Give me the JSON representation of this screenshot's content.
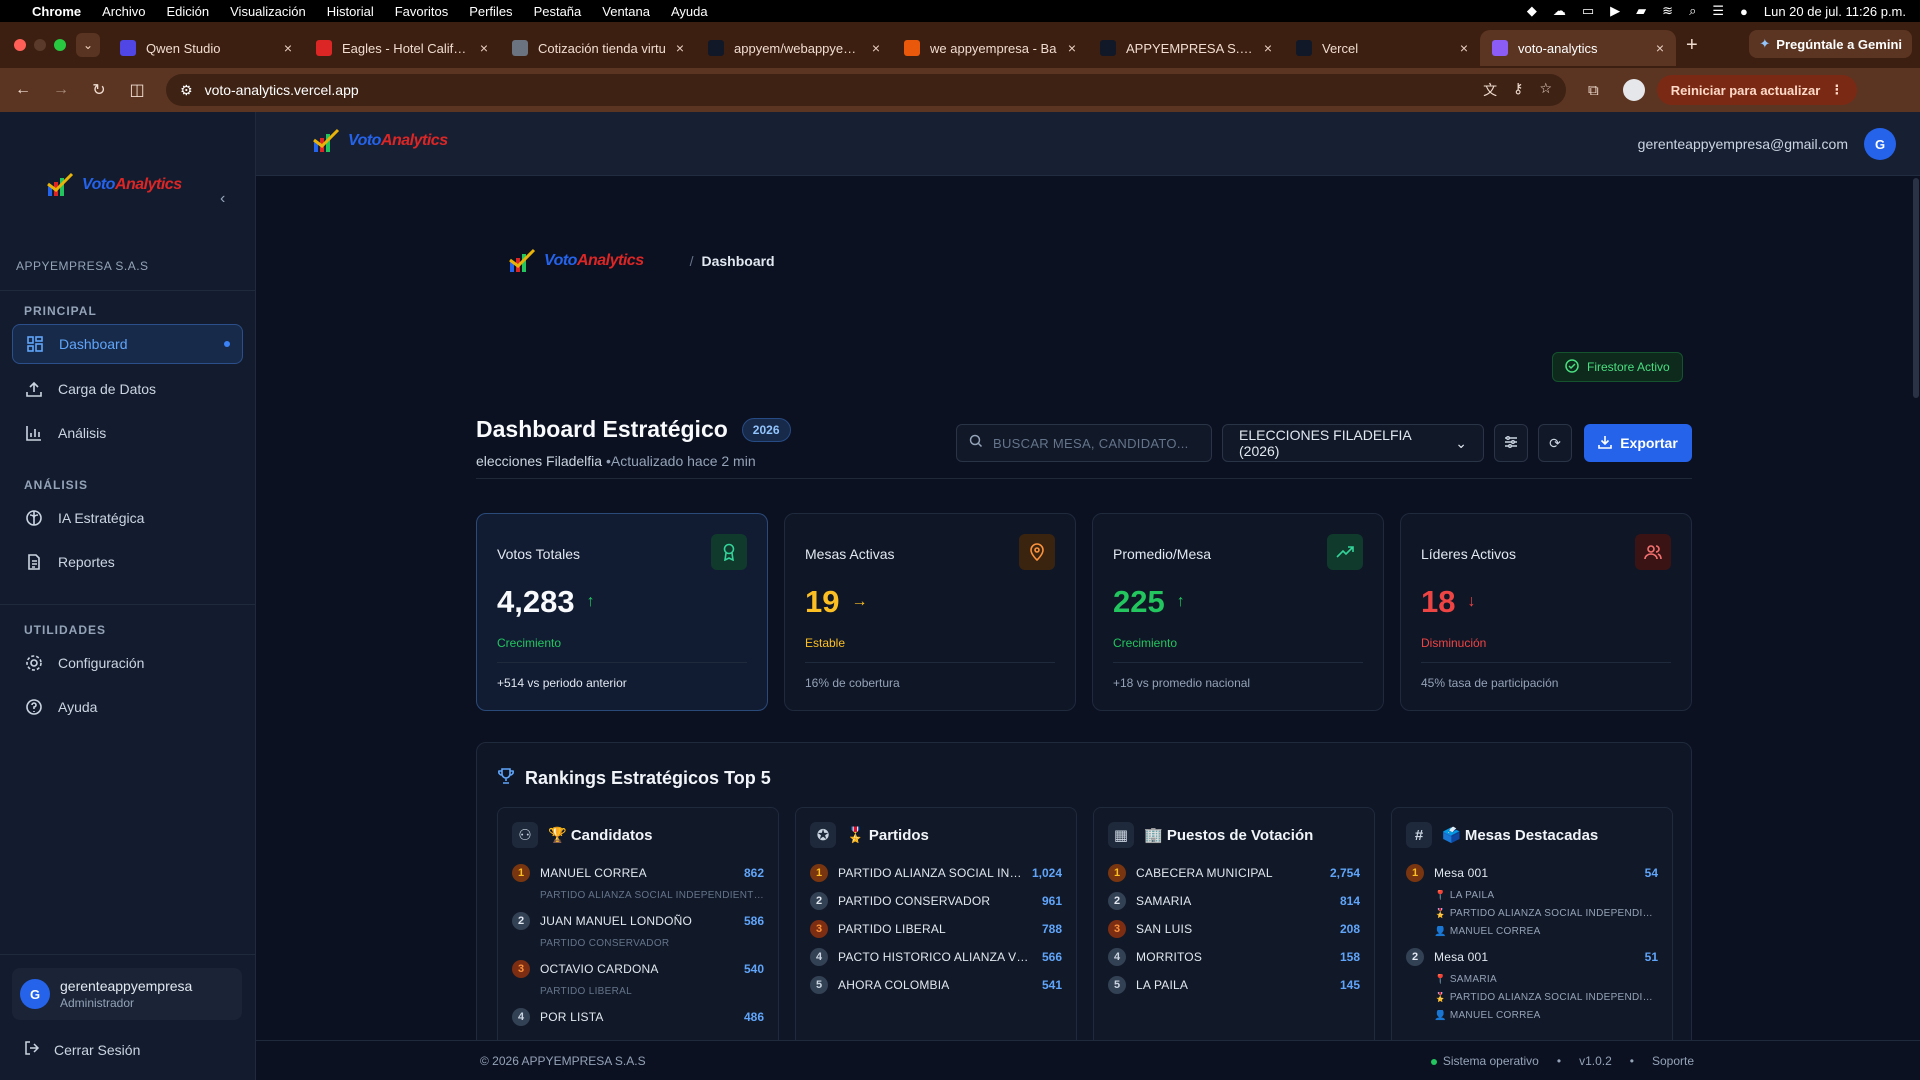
{
  "menubar": {
    "app": "Chrome",
    "items": [
      "Archivo",
      "Edición",
      "Visualización",
      "Historial",
      "Favoritos",
      "Perfiles",
      "Pestaña",
      "Ventana",
      "Ayuda"
    ],
    "datetime": "Lun 20 de jul.  11:26 p.m."
  },
  "tabs": [
    {
      "title": "Qwen Studio",
      "color": "#4f46e5"
    },
    {
      "title": "Eagles - Hotel Californ",
      "color": "#dc2626"
    },
    {
      "title": "Cotización tienda virtu",
      "color": "#6b7280"
    },
    {
      "title": "appyem/webappyempr",
      "color": "#111827"
    },
    {
      "title": "we appyempresa - Ba",
      "color": "#ea580c"
    },
    {
      "title": "APPYEMPRESA S.A.S",
      "color": "#111827"
    },
    {
      "title": "Vercel",
      "color": "#111827"
    },
    {
      "title": "voto-analytics",
      "color": "#8b5cf6"
    }
  ],
  "gemini_label": "Pregúntale a Gemini",
  "url": "voto-analytics.vercel.app",
  "reload_label": "Reiniciar para actualizar",
  "brand": {
    "part1": "Voto",
    "part2": "Analytics"
  },
  "sidebar": {
    "company": "APPYEMPRESA S.A.S",
    "sections": {
      "principal": "PRINCIPAL",
      "analisis": "ANÁLISIS",
      "utilidades": "UTILIDADES"
    },
    "items": {
      "dashboard": "Dashboard",
      "carga": "Carga de Datos",
      "analisis": "Análisis",
      "ia": "IA Estratégica",
      "reportes": "Reportes",
      "config": "Configuración",
      "ayuda": "Ayuda"
    },
    "user": {
      "initial": "G",
      "name": "gerenteappyempresa",
      "role": "Administrador"
    },
    "logout": "Cerrar Sesión"
  },
  "topbar": {
    "email": "gerenteappyempresa@gmail.com",
    "initial": "G"
  },
  "breadcrumb": {
    "sep": "/",
    "page": "Dashboard"
  },
  "firestore": "Firestore Activo",
  "header": {
    "title": "Dashboard Estratégico",
    "year": "2026",
    "subtitle": "elecciones Filadelfia",
    "updated": " •Actualizado hace 2 min"
  },
  "search": {
    "placeholder": "BUSCAR MESA, CANDIDATO..."
  },
  "election_select": "ELECCIONES FILADELFIA (2026)",
  "export_label": "Exportar",
  "cards": [
    {
      "title": "Votos Totales",
      "value": "4,283",
      "arrow": "↑",
      "status": "Crecimiento",
      "foot": "+514 vs periodo anterior",
      "color": "#f8fafc",
      "status_color": "#22c55e",
      "arrow_color": "#22c55e"
    },
    {
      "title": "Mesas Activas",
      "value": "19",
      "arrow": "→",
      "status": "Estable",
      "foot": "16% de cobertura",
      "color": "#fbbf24",
      "status_color": "#fbbf24",
      "arrow_color": "#fbbf24"
    },
    {
      "title": "Promedio/Mesa",
      "value": "225",
      "arrow": "↑",
      "status": "Crecimiento",
      "foot": "+18 vs promedio nacional",
      "color": "#22c55e",
      "status_color": "#22c55e",
      "arrow_color": "#22c55e"
    },
    {
      "title": "Líderes Activos",
      "value": "18",
      "arrow": "↓",
      "status": "Disminución",
      "foot": "45% tasa de participación",
      "color": "#ef4444",
      "status_color": "#ef4444",
      "arrow_color": "#ef4444"
    }
  ],
  "rankings": {
    "title": "Rankings Estratégicos Top 5",
    "candidatos": {
      "title": "🏆 Candidatos",
      "rows": [
        {
          "n": "1",
          "name": "MANUEL CORREA",
          "party": "PARTIDO ALIANZA SOCIAL INDEPENDIENTE ASI",
          "value": "862"
        },
        {
          "n": "2",
          "name": "JUAN MANUEL LONDOÑO",
          "party": "PARTIDO CONSERVADOR",
          "value": "586"
        },
        {
          "n": "3",
          "name": "OCTAVIO CARDONA",
          "party": "PARTIDO LIBERAL",
          "value": "540"
        },
        {
          "n": "4",
          "name": "POR LISTA",
          "party": "",
          "value": "486"
        }
      ]
    },
    "partidos": {
      "title": "🎖️ Partidos",
      "rows": [
        {
          "n": "1",
          "name": "PARTIDO ALIANZA SOCIAL INDEPENDIENTE",
          "value": "1,024"
        },
        {
          "n": "2",
          "name": "PARTIDO CONSERVADOR",
          "value": "961"
        },
        {
          "n": "3",
          "name": "PARTIDO LIBERAL",
          "value": "788"
        },
        {
          "n": "4",
          "name": "PACTO HISTORICO ALIANZA VERDE",
          "value": "566"
        },
        {
          "n": "5",
          "name": "AHORA COLOMBIA",
          "value": "541"
        }
      ]
    },
    "puestos": {
      "title": "🏢 Puestos de Votación",
      "rows": [
        {
          "n": "1",
          "name": "CABECERA MUNICIPAL",
          "value": "2,754"
        },
        {
          "n": "2",
          "name": "SAMARIA",
          "value": "814"
        },
        {
          "n": "3",
          "name": "SAN LUIS",
          "value": "208"
        },
        {
          "n": "4",
          "name": "MORRITOS",
          "value": "158"
        },
        {
          "n": "5",
          "name": "LA PAILA",
          "value": "145"
        }
      ]
    },
    "mesas": {
      "title": "🗳️ Mesas Destacadas",
      "rows": [
        {
          "n": "1",
          "name": "Mesa 001",
          "value": "54",
          "place": "📍 LA PAILA",
          "party": "🎖️ PARTIDO ALIANZA SOCIAL INDEPENDIENTE",
          "candidate": "👤 MANUEL CORREA"
        },
        {
          "n": "2",
          "name": "Mesa 001",
          "value": "51",
          "place": "📍 SAMARIA",
          "party": "🎖️ PARTIDO ALIANZA SOCIAL INDEPENDIENTE",
          "candidate": "👤 MANUEL CORREA"
        }
      ]
    }
  },
  "footer": {
    "copy": "© 2026 ",
    "company": "APPYEMPRESA S.A.S",
    "status": "Sistema operativo",
    "version": "v1.0.2",
    "support": "Soporte"
  }
}
